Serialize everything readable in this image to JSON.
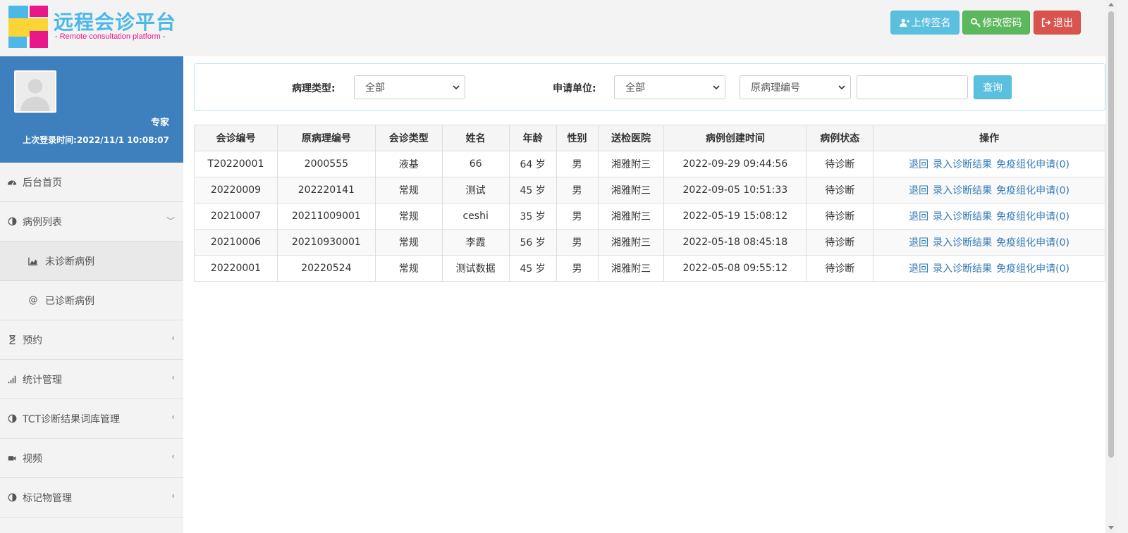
{
  "header": {
    "logo_title": "远程会诊平台",
    "logo_subtitle": "- Remote consultation platform -",
    "buttons": {
      "upload_signature": "上传签名",
      "change_password": "修改密码",
      "logout": "退出"
    }
  },
  "profile": {
    "role": "专家",
    "last_login": "上次登录时间:2022/11/1 10:08:07"
  },
  "sidebar": {
    "items": [
      {
        "label": "后台首页",
        "icon": "dashboard-icon"
      },
      {
        "label": "病例列表",
        "icon": "adjust-icon",
        "expanded": true
      },
      {
        "label": "未诊断病例",
        "icon": "area-chart-icon",
        "sub": true,
        "active": true
      },
      {
        "label": "已诊断病例",
        "icon": "at-icon",
        "sub": true
      },
      {
        "label": "预约",
        "icon": "hourglass-icon"
      },
      {
        "label": "统计管理",
        "icon": "signal-icon"
      },
      {
        "label": "TCT诊断结果词库管理",
        "icon": "adjust-icon"
      },
      {
        "label": "视频",
        "icon": "video-camera-icon"
      },
      {
        "label": "标记物管理",
        "icon": "adjust-icon"
      }
    ]
  },
  "filters": {
    "pathology_type_label": "病理类型:",
    "pathology_type_value": "全部",
    "applicant_label": "申请单位:",
    "applicant_value": "全部",
    "field_value": "原病理编号",
    "search_value": "",
    "search_button": "查询"
  },
  "table": {
    "headers": [
      "会诊编号",
      "原病理编号",
      "会诊类型",
      "姓名",
      "年龄",
      "性别",
      "送检医院",
      "病例创建时间",
      "病例状态",
      "操作"
    ],
    "actions": [
      "退回",
      "录入诊断结果",
      "免疫组化申请(0)"
    ],
    "rows": [
      [
        "T20220001",
        "2000555",
        "液基",
        "66",
        "64 岁",
        "男",
        "湘雅附三",
        "2022-09-29 09:44:56",
        "待诊断"
      ],
      [
        "20220009",
        "202220141",
        "常规",
        "测试",
        "45 岁",
        "男",
        "湘雅附三",
        "2022-09-05 10:51:33",
        "待诊断"
      ],
      [
        "20210007",
        "20211009001",
        "常规",
        "ceshi",
        "35 岁",
        "男",
        "湘雅附三",
        "2022-05-19 15:08:12",
        "待诊断"
      ],
      [
        "20210006",
        "20210930001",
        "常规",
        "李霞",
        "56 岁",
        "男",
        "湘雅附三",
        "2022-05-18 08:45:18",
        "待诊断"
      ],
      [
        "20220001",
        "20220524",
        "常规",
        "测试数据",
        "45 岁",
        "男",
        "湘雅附三",
        "2022-05-08 09:55:12",
        "待诊断"
      ]
    ]
  },
  "colors": {
    "sidebar_profile_bg": "#3d80bd",
    "info": "#5bc0de",
    "success": "#5cb85c",
    "danger": "#d9534f",
    "link": "#337ab7"
  }
}
